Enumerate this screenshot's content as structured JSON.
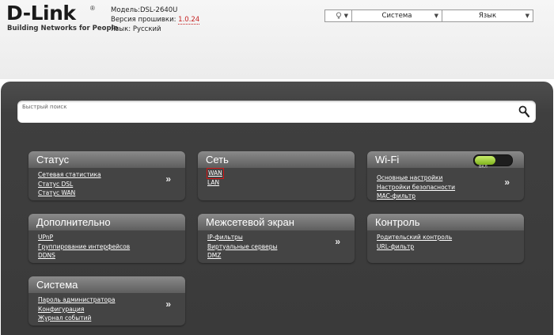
{
  "header": {
    "brand": "D-Link",
    "registered": "®",
    "tagline": "Building Networks for People",
    "model_label": "Модель:",
    "model": "DSL-2640U",
    "firmware_label": "Версия прошивки:",
    "firmware": "1.0.24",
    "language_label": "Язык:",
    "language": "Русский"
  },
  "topbar": {
    "help_icon": "lightbulb-icon",
    "system_label": "Система",
    "lang_label": "Язык"
  },
  "search": {
    "placeholder": "Быстрый поиск",
    "icon": "magnifier-icon"
  },
  "cards": {
    "status": {
      "title": "Статус",
      "links": [
        "Сетевая статистика",
        "Статус DSL",
        "Статус WAN"
      ]
    },
    "network": {
      "title": "Сеть",
      "links": [
        "WAN",
        "LAN"
      ]
    },
    "wifi": {
      "title": "Wi-Fi",
      "toggle_label": "ВКЛ",
      "toggle_state": "on",
      "links": [
        "Основные настройки",
        "Настройки безопасности",
        "MAC-фильтр"
      ]
    },
    "advanced": {
      "title": "Дополнительно",
      "links": [
        "UPnP",
        "Группирование интерфейсов",
        "DDNS"
      ]
    },
    "firewall": {
      "title": "Межсетевой экран",
      "links": [
        "IP-фильтры",
        "Виртуальные серверы",
        "DMZ"
      ]
    },
    "control": {
      "title": "Контроль",
      "links": [
        "Родительский контроль",
        "URL-фильтр"
      ]
    },
    "system": {
      "title": "Система",
      "links": [
        "Пароль администратора",
        "Конфигурация",
        "Журнал событий"
      ]
    }
  },
  "chevron": "»",
  "colors": {
    "panel_bg": "#3a3a3a",
    "card_head": "#7a7a7a",
    "highlight_border": "#d01515",
    "firmware_text": "#c41e1e",
    "toggle_on": "#9fd03a"
  }
}
